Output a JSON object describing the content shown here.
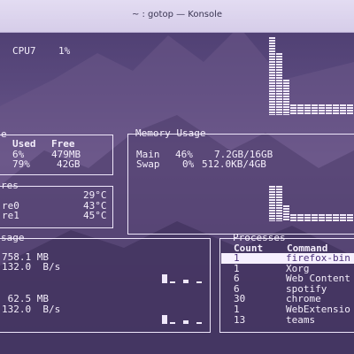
{
  "window": {
    "title": "~ : gotop — Konsole"
  },
  "cpu": {
    "label": "CPU7",
    "value": "1%"
  },
  "disk": {
    "title": "e",
    "headers": {
      "used": "Used",
      "free": "Free"
    },
    "rows": [
      {
        "used": "6%",
        "free": "479MB"
      },
      {
        "used": "79%",
        "free": "42GB"
      }
    ]
  },
  "memory": {
    "title": "Memory Usage",
    "rows": [
      {
        "name": "Main",
        "pct": "46%",
        "amount": "7.2GB/16GB"
      },
      {
        "name": "Swap",
        "pct": "0%",
        "amount": "512.0KB/4GB"
      }
    ]
  },
  "temps": {
    "title": "res",
    "rows": [
      {
        "name": "",
        "value": "29°C"
      },
      {
        "name": "re0",
        "value": "43°C"
      },
      {
        "name": "re1",
        "value": "45°C"
      }
    ]
  },
  "network": {
    "title": "sage",
    "rx_total": "758.1 MB",
    "rx_rate": "132.0  B/s",
    "tx_total": " 62.5 MB",
    "tx_rate": "132.0  B/s"
  },
  "processes": {
    "title": "Processes",
    "headers": {
      "count": "Count",
      "command": "Command"
    },
    "rows": [
      {
        "count": "1",
        "command": "firefox-bin"
      },
      {
        "count": "1",
        "command": "Xorg"
      },
      {
        "count": "6",
        "command": "Web Content"
      },
      {
        "count": "6",
        "command": "spotify"
      },
      {
        "count": "30",
        "command": "chrome"
      },
      {
        "count": "1",
        "command": "WebExtensio"
      },
      {
        "count": "13",
        "command": "teams"
      }
    ],
    "selected_index": 0
  },
  "colors": {
    "text": "#f4eefb",
    "selected_bg": "#f6f0ff",
    "selected_fg": "#4a2f7a"
  }
}
